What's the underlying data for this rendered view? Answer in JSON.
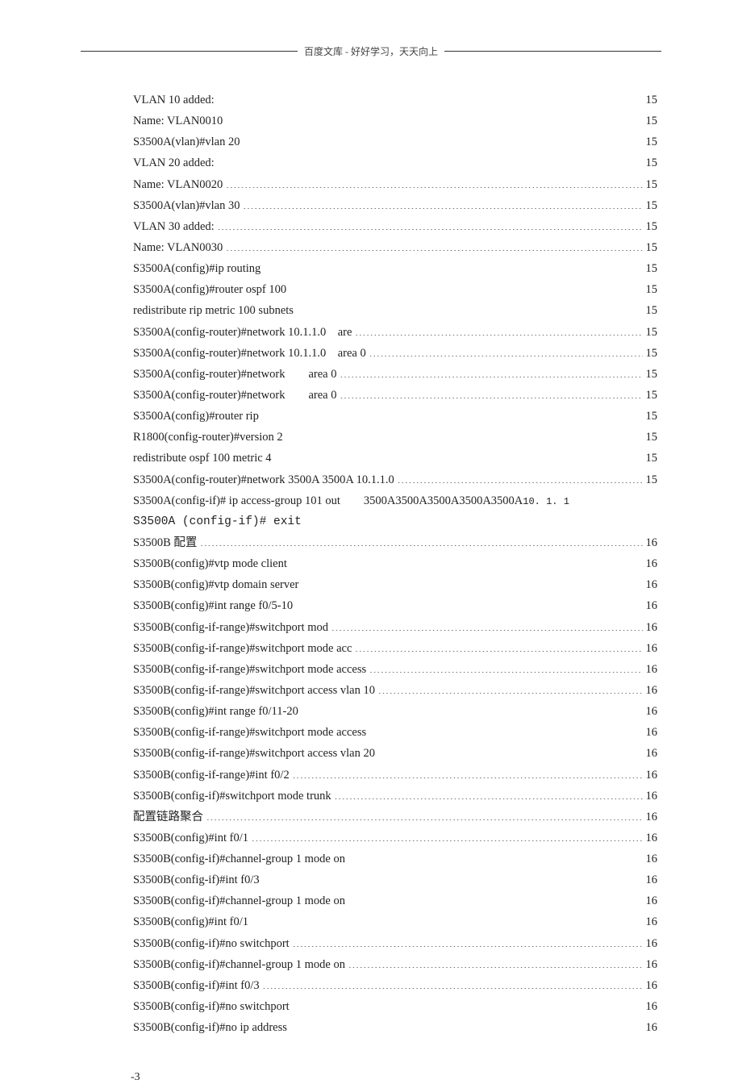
{
  "header": "百度文库 - 好好学习，天天向上",
  "page_number": "-3",
  "entries": [
    {
      "kind": "dot",
      "label": "VLAN 10 added:",
      "page": "15"
    },
    {
      "kind": "dot",
      "label": "Name: VLAN0010",
      "page": "15"
    },
    {
      "kind": "dot",
      "label": "S3500A(vlan)#vlan 20",
      "page": "15"
    },
    {
      "kind": "dot",
      "label": "VLAN 20 added:",
      "page": "15"
    },
    {
      "kind": "dot",
      "label": "Name: VLAN0020",
      "page": "15"
    },
    {
      "kind": "dot",
      "label": "S3500A(vlan)#vlan 30",
      "page": "15"
    },
    {
      "kind": "dot",
      "label": "VLAN 30 added:",
      "page": "15"
    },
    {
      "kind": "dot",
      "label": "Name: VLAN0030",
      "page": "15"
    },
    {
      "kind": "dot",
      "label": "S3500A(config)#ip routing",
      "page": "15"
    },
    {
      "kind": "dot",
      "label": "S3500A(config)#router ospf 100",
      "page": "15"
    },
    {
      "kind": "dot",
      "label": "redistribute rip metric 100 subnets",
      "page": "15"
    },
    {
      "kind": "dot",
      "label": "S3500A(config-router)#network 10.1.1.0 are",
      "page": "15"
    },
    {
      "kind": "dot",
      "label": "S3500A(config-router)#network 10.1.1.0 area 0",
      "page": "15"
    },
    {
      "kind": "dot",
      "label": "S3500A(config-router)#network  area 0",
      "page": "15"
    },
    {
      "kind": "dot",
      "label": "S3500A(config-router)#network  area 0",
      "page": "15"
    },
    {
      "kind": "dot",
      "label": "S3500A(config)#router rip",
      "page": "15"
    },
    {
      "kind": "dot",
      "label": "R1800(config-router)#version 2",
      "page": "15"
    },
    {
      "kind": "dot",
      "label": "redistribute ospf 100 metric 4",
      "page": "15"
    },
    {
      "kind": "dot",
      "label": "S3500A(config-router)#network 3500A 3500A 10.1.1.0",
      "page": "15"
    },
    {
      "kind": "plain_tail",
      "label": "S3500A(config-if)# ip access-group 101 out  3500A3500A3500A3500A3500A",
      "tail": "10. 1. 1"
    },
    {
      "kind": "plain_mono",
      "label": "S3500A (config-if)# exit"
    },
    {
      "kind": "dot",
      "label": "S3500B 配置",
      "page": "16"
    },
    {
      "kind": "dot",
      "label": "S3500B(config)#vtp mode client",
      "page": "16"
    },
    {
      "kind": "dot",
      "label": "S3500B(config)#vtp domain server",
      "page": "16"
    },
    {
      "kind": "dot",
      "label": "S3500B(config)#int range f0/5-10",
      "page": "16"
    },
    {
      "kind": "dot",
      "label": "S3500B(config-if-range)#switchport mod",
      "page": "16"
    },
    {
      "kind": "dot",
      "label": "S3500B(config-if-range)#switchport mode acc",
      "page": "16"
    },
    {
      "kind": "dot",
      "label": "S3500B(config-if-range)#switchport mode access",
      "page": "16"
    },
    {
      "kind": "dot",
      "label": "S3500B(config-if-range)#switchport access vlan 10",
      "page": "16"
    },
    {
      "kind": "dot",
      "label": "S3500B(config)#int range f0/11-20",
      "page": "16"
    },
    {
      "kind": "dot",
      "label": "S3500B(config-if-range)#switchport mode access",
      "page": "16"
    },
    {
      "kind": "dot",
      "label": "S3500B(config-if-range)#switchport access vlan 20",
      "page": "16"
    },
    {
      "kind": "dot",
      "label": "S3500B(config-if-range)#int f0/2",
      "page": "16"
    },
    {
      "kind": "dot",
      "label": "S3500B(config-if)#switchport mode trunk",
      "page": "16"
    },
    {
      "kind": "dot",
      "label": "配置链路聚合",
      "page": "16"
    },
    {
      "kind": "dot",
      "label": "S3500B(config)#int f0/1",
      "page": "16"
    },
    {
      "kind": "dot",
      "label": "S3500B(config-if)#channel-group 1 mode on",
      "page": "16"
    },
    {
      "kind": "dot",
      "label": "S3500B(config-if)#int f0/3",
      "page": "16"
    },
    {
      "kind": "dot",
      "label": "S3500B(config-if)#channel-group 1 mode on",
      "page": "16"
    },
    {
      "kind": "dot",
      "label": "S3500B(config)#int f0/1",
      "page": "16"
    },
    {
      "kind": "dot",
      "label": "S3500B(config-if)#no switchport",
      "page": "16"
    },
    {
      "kind": "dot",
      "label": "S3500B(config-if)#channel-group 1 mode on",
      "page": "16"
    },
    {
      "kind": "dot",
      "label": "S3500B(config-if)#int f0/3",
      "page": "16"
    },
    {
      "kind": "dot",
      "label": "S3500B(config-if)#no switchport",
      "page": "16"
    },
    {
      "kind": "dot",
      "label": "S3500B(config-if)#no ip address",
      "page": "16"
    }
  ]
}
